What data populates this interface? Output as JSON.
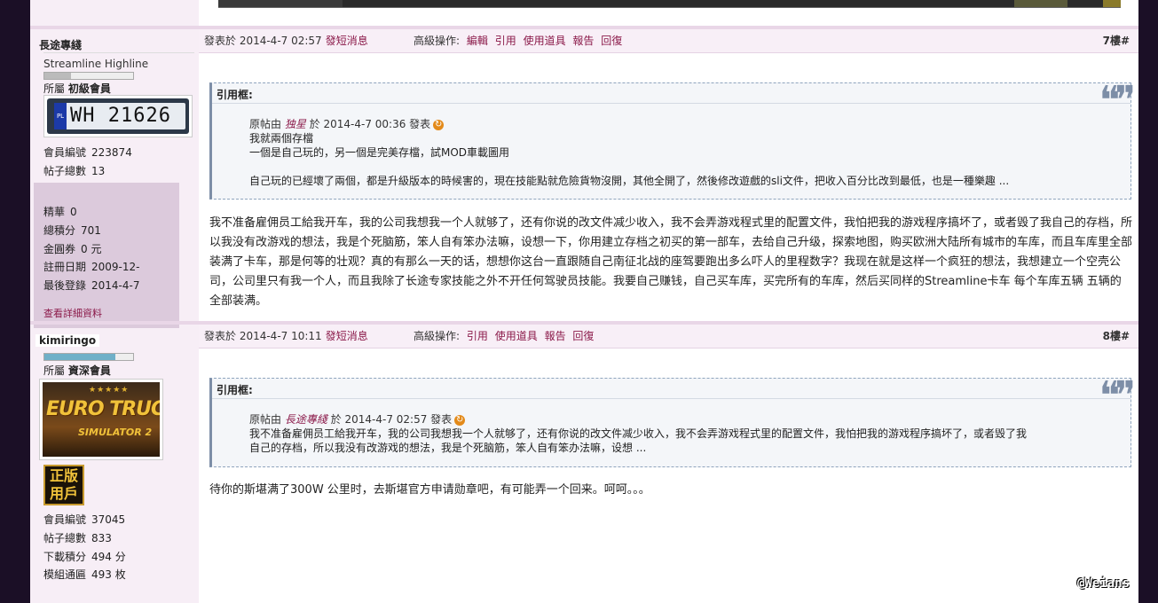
{
  "post7": {
    "user": {
      "name": "長途專綫",
      "title": "Streamline Highline",
      "progress": 0.3,
      "group_label": "所屬",
      "group": "初級會員",
      "plate_country": "PL",
      "plate_number": "WH 21626",
      "member_id_label": "會員編號",
      "member_id": "223874",
      "posts_label": "帖子總數",
      "posts": "13",
      "essence_label": "精華",
      "essence": "0",
      "points_label": "總積分",
      "points": "701",
      "coins_label": "金圓券",
      "coins": "0 元",
      "reg_label": "註冊日期",
      "reg_date": "2009-12-",
      "last_label": "最後登錄",
      "last_login": "2014-4-7",
      "detail_link": "查看詳細資料"
    },
    "header": {
      "posted": "發表於 2014-4-7 02:57",
      "sms": "發短消息",
      "ops_label": "高級操作:",
      "ops": [
        "編輯",
        "引用",
        "使用道具",
        "報告",
        "回復"
      ],
      "floor": "7樓#"
    },
    "quote": {
      "title": "引用框:",
      "meta_prefix": "原帖由",
      "author": "独星",
      "meta_suffix": "於 2014-4-7 00:36 發表",
      "lines": [
        "我就兩個存檔",
        "一個是自己玩的，另一個是完美存檔，試MOD車載圖用",
        "",
        "自己玩的已經壞了兩個，都是升級版本的時候害的，現在技能點就危險貨物沒開，其他全開了，然後修改遊戲的sli文件，把收入百分比改到最低，也是一種樂趣 ..."
      ]
    },
    "body": "我不准备雇佣员工給我开车，我的公司我想我一个人就够了，还有你说的改文件减少收入，我不会弄游戏程式里的配置文件，我怕把我的游戏程序搞坏了，或者毁了我自己的存档，所以我没有改游戏的想法，我是个死脑筋，笨人自有笨办法嘛，设想一下，你用建立存档之初买的第一部车，去给自己升级，探索地图，购买欧洲大陆所有城市的车库，而且车库里全部装满了卡车，那是何等的壮观？真的有那么一天的话，想想你这台一直跟随自己南征北战的座驾要跑出多么吓人的里程数字？我现在就是这样一个疯狂的想法，我想建立一个空壳公司，公司里只有我一个人，而且我除了长途专家技能之外不开任何驾驶员技能。我要自己赚钱，自己买车库，买完所有的车库，然后买同样的Streamline卡车  每个车库五辆 五辆的全部装满。"
  },
  "post8": {
    "user": {
      "name": "kimiringo",
      "progress": 0.8,
      "group_label": "所屬",
      "group": "資深會員",
      "avatar_title": "EURO TRUCK",
      "avatar_subtitle": "SIMULATOR 2",
      "badge": "正版用戶",
      "member_id_label": "會員編號",
      "member_id": "37045",
      "posts_label": "帖子總數",
      "posts": "833",
      "download_label": "下載積分",
      "download": "494 分",
      "mod_label": "模組通匾",
      "mod": "493 枚"
    },
    "header": {
      "posted": "發表於 2014-4-7 10:11",
      "sms": "發短消息",
      "ops_label": "高級操作:",
      "ops": [
        "引用",
        "使用道具",
        "報告",
        "回復"
      ],
      "floor": "8樓#"
    },
    "quote": {
      "title": "引用框:",
      "meta_prefix": "原帖由",
      "author": "長途專綫",
      "meta_suffix": "於 2014-4-7 02:57 發表",
      "lines": [
        "我不准备雇佣员工給我开车，我的公司我想我一个人就够了，还有你说的改文件减少收入，我不会弄游戏程式里的配置文件，我怕把我的游戏程序搞坏了，或者毁了我",
        "自己的存档，所以我没有改游戏的想法，我是个死脑筋，笨人自有笨办法嘛，设想 ..."
      ]
    },
    "body": "待你的斯堪满了300W 公里时，去斯堪官方申请勋章吧，有可能弄一个回来。呵呵。。。"
  },
  "watermark": "@Weians",
  "colors": {
    "link": "#8b1a4a",
    "sidebar_bg": "#f7eef6",
    "header_bg": "#f8eff7",
    "quote_border": "#7d8ea7"
  }
}
